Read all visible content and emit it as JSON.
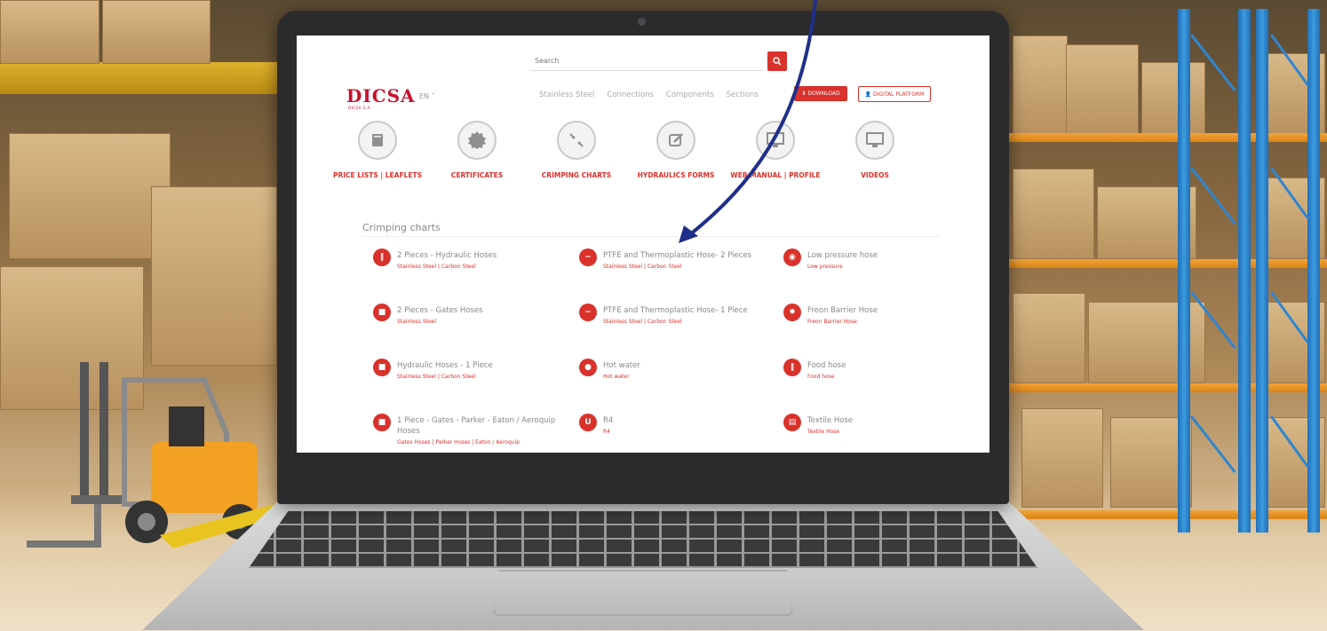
{
  "search": {
    "placeholder": "Search",
    "button_icon": "search-icon"
  },
  "brand": {
    "logo_text": "DICSA",
    "logo_sub": "DICSA S.A.",
    "lang": "EN ˅"
  },
  "nav": {
    "items": [
      "Stainless Steel",
      "Connections",
      "Components",
      "Sections"
    ]
  },
  "buttons": {
    "download": "⬇ DOWNLOAD",
    "platform": "👤 DIGITAL PLATFORM"
  },
  "icons": [
    {
      "label": "PRICE LISTS | LEAFLETS",
      "icon": "book-icon"
    },
    {
      "label": "CERTIFICATES",
      "icon": "seal-icon"
    },
    {
      "label": "CRIMPING CHARTS",
      "icon": "crimp-icon"
    },
    {
      "label": "HYDRAULICS FORMS",
      "icon": "edit-form-icon"
    },
    {
      "label": "WEB MANUAL | PROFILE",
      "icon": "monitor-icon"
    },
    {
      "label": "VIDEOS",
      "icon": "monitor-icon"
    }
  ],
  "section_title": "Crimping charts",
  "charts": [
    {
      "title": "2 Pieces - Hydraulic Hoses",
      "sub": "Stainless Steel | Carbon Steel",
      "glyph": "‖"
    },
    {
      "title": "PTFE and Thermoplastic Hose- 2 Pieces",
      "sub": "Stainless Steel | Carbon Steel",
      "glyph": "−"
    },
    {
      "title": "Low pressure hose",
      "sub": "Low pressure",
      "glyph": "◉"
    },
    {
      "title": "2 Pieces - Gates Hoses",
      "sub": "Stainless Steel",
      "glyph": "■"
    },
    {
      "title": "PTFE and Thermoplastic Hose- 1 Piece",
      "sub": "Stainless Steel | Carbon Steel",
      "glyph": "−"
    },
    {
      "title": "Freon Barrier Hose",
      "sub": "Freon Barrier Hose",
      "glyph": "✹"
    },
    {
      "title": "Hydraulic Hoses - 1 Piece",
      "sub": "Stainless Steel | Carbon Steel",
      "glyph": "■"
    },
    {
      "title": "Hot water",
      "sub": "Hot water",
      "glyph": "●"
    },
    {
      "title": "Food hose",
      "sub": "Food hose",
      "glyph": "‖"
    },
    {
      "title": "1 Piece - Gates - Parker - Eaton / Aeroquip Hoses",
      "sub": "Gates Hoses | Parker Hoses | Eaton / Aeroquip",
      "glyph": "■"
    },
    {
      "title": "R4",
      "sub": "R4",
      "glyph": "U"
    },
    {
      "title": "Textile Hose",
      "sub": "Textile Hose",
      "glyph": "▤"
    }
  ],
  "colors": {
    "accent": "#d9312b",
    "arrow": "#1f2f8a",
    "rack_blue": "#2f86d0",
    "rack_orange": "#f2a33a"
  }
}
